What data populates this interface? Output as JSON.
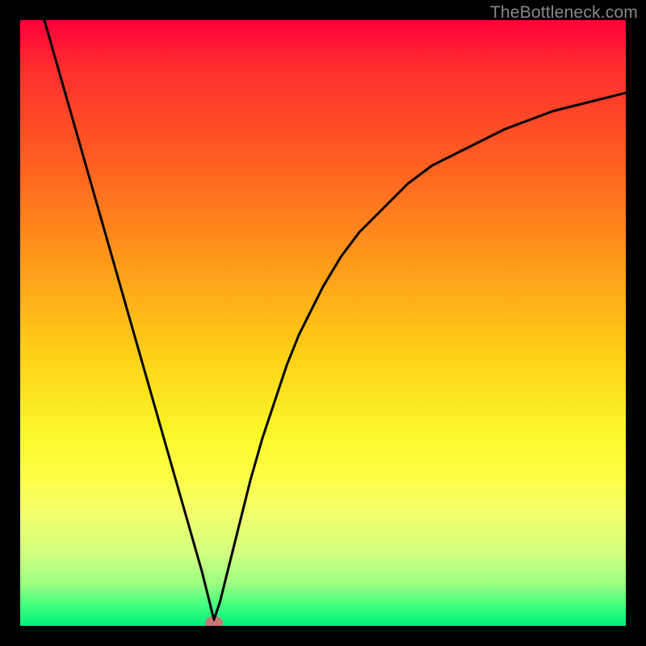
{
  "watermark": "TheBottleneck.com",
  "chart_data": {
    "type": "line",
    "title": "",
    "xlabel": "",
    "ylabel": "",
    "xlim": [
      0,
      100
    ],
    "ylim": [
      0,
      100
    ],
    "marker": {
      "x": 32,
      "y": 0.5
    },
    "series": [
      {
        "name": "bottleneck-curve",
        "x": [
          4,
          6,
          8,
          10,
          12,
          14,
          16,
          18,
          20,
          22,
          24,
          26,
          28,
          30,
          31,
          32,
          33,
          34,
          36,
          38,
          40,
          42,
          44,
          46,
          48,
          50,
          53,
          56,
          60,
          64,
          68,
          72,
          76,
          80,
          84,
          88,
          92,
          96,
          100
        ],
        "y": [
          100,
          93,
          86,
          79,
          72,
          65,
          58,
          51,
          44,
          37,
          30,
          23,
          16,
          9,
          5,
          1,
          4,
          8,
          16,
          24,
          31,
          37,
          43,
          48,
          52,
          56,
          61,
          65,
          69,
          73,
          76,
          78,
          80,
          82,
          83.5,
          85,
          86,
          87,
          88
        ]
      }
    ],
    "gradient_stops": [
      {
        "pos": 0,
        "color": "#ff003a"
      },
      {
        "pos": 8,
        "color": "#ff2e2e"
      },
      {
        "pos": 22,
        "color": "#ff5a22"
      },
      {
        "pos": 40,
        "color": "#ff9a1a"
      },
      {
        "pos": 55,
        "color": "#ffcf16"
      },
      {
        "pos": 68,
        "color": "#faf727"
      },
      {
        "pos": 75,
        "color": "#feff44"
      },
      {
        "pos": 82,
        "color": "#f0ff6d"
      },
      {
        "pos": 88,
        "color": "#d2ff80"
      },
      {
        "pos": 93,
        "color": "#9cff80"
      },
      {
        "pos": 97,
        "color": "#3aff80"
      },
      {
        "pos": 100,
        "color": "#00ef7a"
      }
    ]
  }
}
